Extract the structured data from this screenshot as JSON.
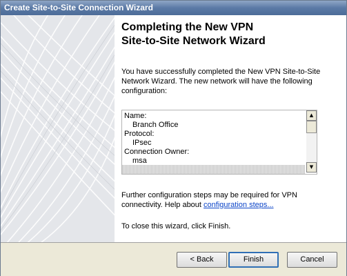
{
  "window": {
    "title": "Create Site-to-Site Connection Wizard"
  },
  "page": {
    "heading_line1": "Completing the New VPN",
    "heading_line2": "Site-to-Site Network Wizard",
    "intro": "You have successfully completed the New VPN Site-to-Site Network Wizard. The new network will have the following configuration:",
    "summary": [
      {
        "text": "Name:",
        "indent": false
      },
      {
        "text": "Branch Office",
        "indent": true
      },
      {
        "text": "Protocol:",
        "indent": false
      },
      {
        "text": "IPsec",
        "indent": true
      },
      {
        "text": "Connection Owner:",
        "indent": false
      },
      {
        "text": "msa",
        "indent": true
      }
    ],
    "further_text": "Further configuration steps may be required for VPN connectivity. Help about",
    "further_link": "configuration steps...",
    "close_text": "To close this wizard, click Finish."
  },
  "scroll_arrows": {
    "up": "▲",
    "down": "▼"
  },
  "buttons": {
    "back": "< Back",
    "finish": "Finish",
    "cancel": "Cancel"
  }
}
